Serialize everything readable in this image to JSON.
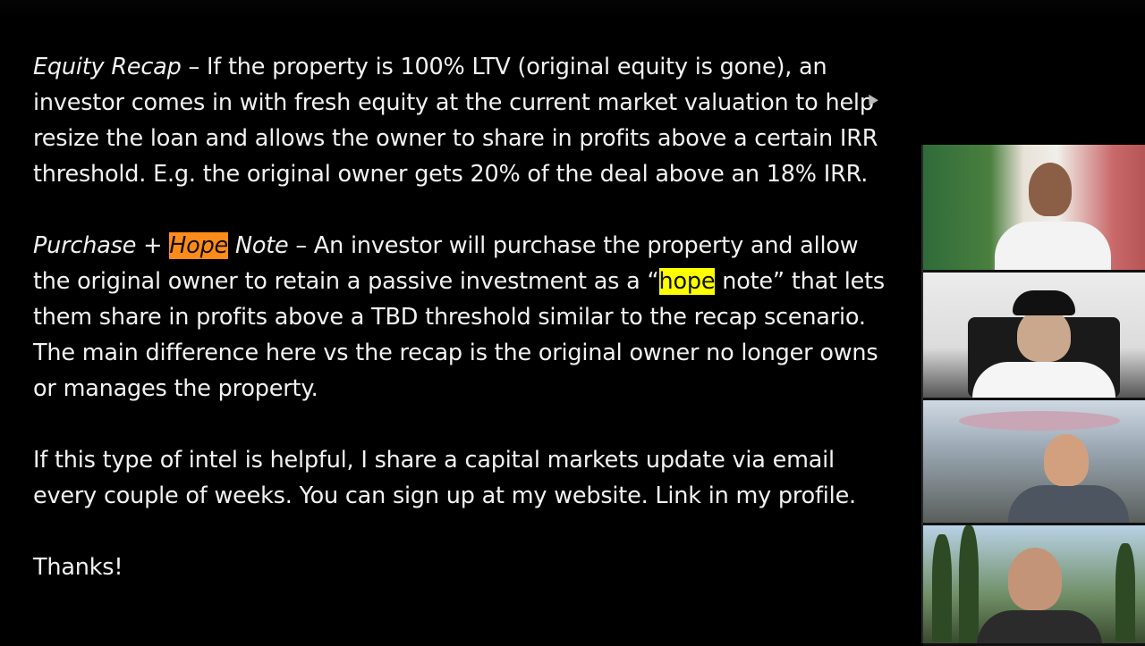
{
  "document": {
    "p1": {
      "term": "Equity Recap",
      "text": " – If the property is 100% LTV (original equity is gone), an investor comes in with fresh equity at the current market valuation to help resize the loan and allows the owner to share in profits above a certain IRR threshold. E.g. the original owner gets 20% of the deal above an 18% IRR."
    },
    "p2": {
      "term_a": "Purchase + ",
      "term_hl": "Hope",
      "term_b": " Note",
      "text_a": " – An investor will purchase the property and allow the original owner to retain a passive investment as a “",
      "text_hl": "hope",
      "text_b": " note” that lets them share in profits above a TBD threshold similar to the recap scenario. The main difference here vs the recap is the original owner no longer owns or manages the property."
    },
    "p3": "If this type of intel is helpful, I share a capital markets update via email every couple of weeks. You can sign up at my website. Link in my profile.",
    "p4": "Thanks!"
  },
  "highlight_colors": {
    "orange": "#ff8c1a",
    "yellow": "#ffff00"
  },
  "participants": [
    "video-participant-1",
    "video-participant-2",
    "video-participant-3",
    "video-participant-4"
  ]
}
